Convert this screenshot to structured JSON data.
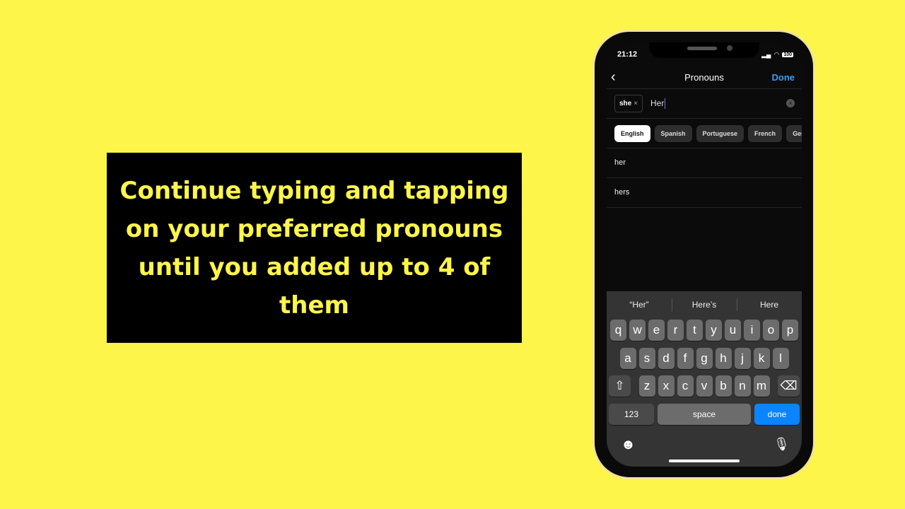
{
  "caption": "Continue typing and tapping on your preferred pronouns until you added up to 4 of them",
  "status": {
    "time": "21:12",
    "battery": "100"
  },
  "header": {
    "title": "Pronouns",
    "done_label": "Done",
    "back_icon": "chevron-left-icon"
  },
  "input": {
    "chip": "she",
    "chip_remove": "×",
    "value": "Her"
  },
  "languages": [
    {
      "label": "English",
      "selected": true
    },
    {
      "label": "Spanish"
    },
    {
      "label": "Portuguese"
    },
    {
      "label": "French"
    },
    {
      "label": "Ger"
    }
  ],
  "results": [
    "her",
    "hers"
  ],
  "keyboard": {
    "suggestions": [
      "“Her”",
      "Here’s",
      "Here"
    ],
    "row1": [
      "q",
      "w",
      "e",
      "r",
      "t",
      "y",
      "u",
      "i",
      "o",
      "p"
    ],
    "row2": [
      "a",
      "s",
      "d",
      "f",
      "g",
      "h",
      "j",
      "k",
      "l"
    ],
    "row3": [
      "z",
      "x",
      "c",
      "v",
      "b",
      "n",
      "m"
    ],
    "numbers_label": "123",
    "space_label": "space",
    "done_label": "done",
    "accent": "#0a84ff"
  }
}
